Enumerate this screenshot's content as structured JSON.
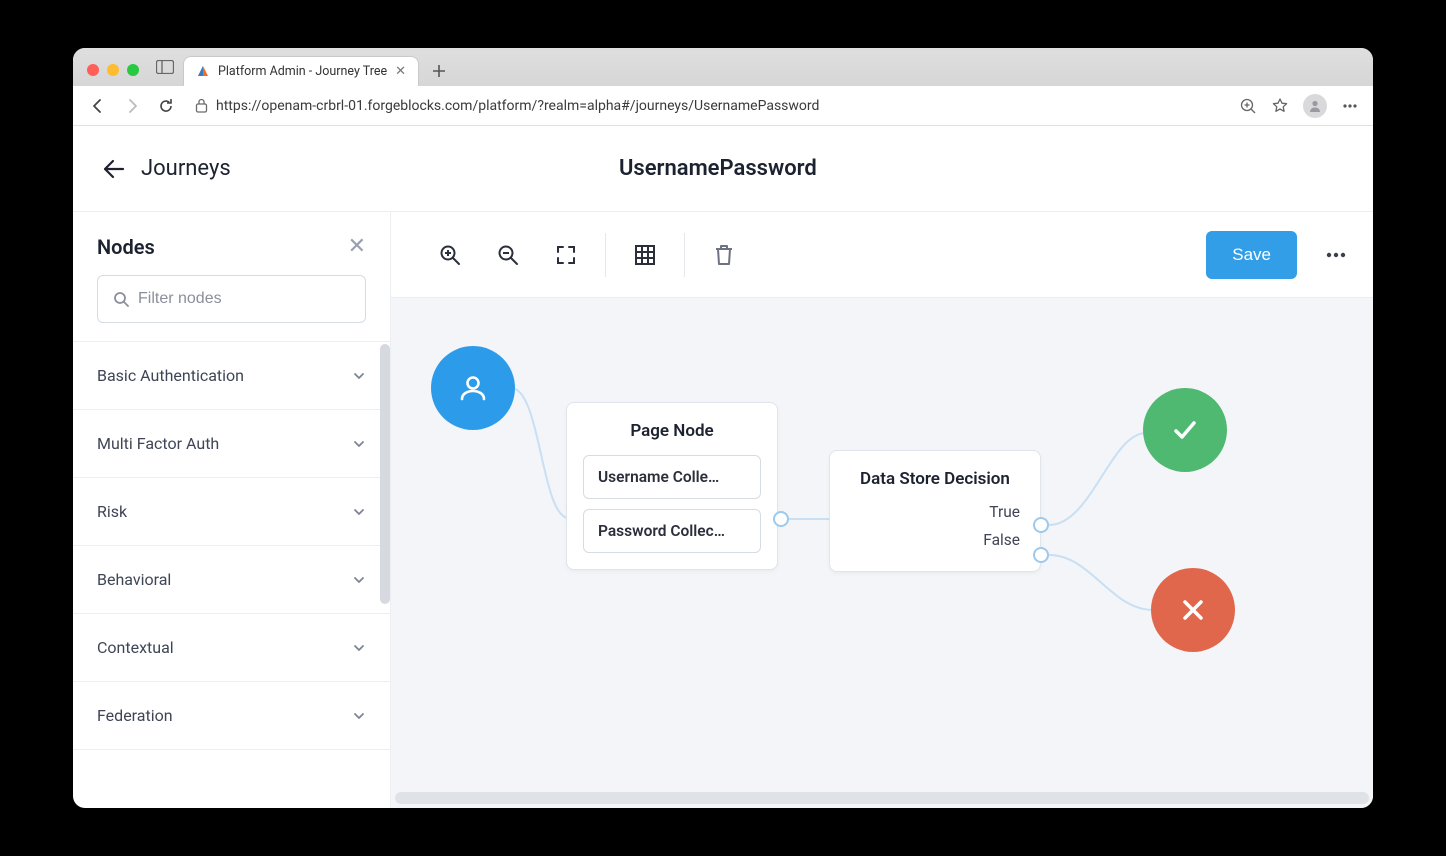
{
  "browser": {
    "tab_title": "Platform Admin - Journey Tree",
    "url": "https://openam-crbrl-01.forgeblocks.com/platform/?realm=alpha#/journeys/UsernamePassword"
  },
  "header": {
    "back_label": "Journeys",
    "title": "UsernamePassword"
  },
  "sidebar": {
    "title": "Nodes",
    "filter_placeholder": "Filter nodes",
    "categories": [
      {
        "label": "Basic Authentication"
      },
      {
        "label": "Multi Factor Auth"
      },
      {
        "label": "Risk"
      },
      {
        "label": "Behavioral"
      },
      {
        "label": "Contextual"
      },
      {
        "label": "Federation"
      }
    ]
  },
  "toolbar": {
    "save_label": "Save"
  },
  "canvas": {
    "page_node": {
      "title": "Page Node",
      "items": [
        "Username Colle…",
        "Password Collec…"
      ]
    },
    "ds_node": {
      "title": "Data Store Decision",
      "outcomes": [
        "True",
        "False"
      ]
    }
  },
  "colors": {
    "primary": "#329ee8",
    "success": "#4fb971",
    "fail": "#e1674c"
  }
}
